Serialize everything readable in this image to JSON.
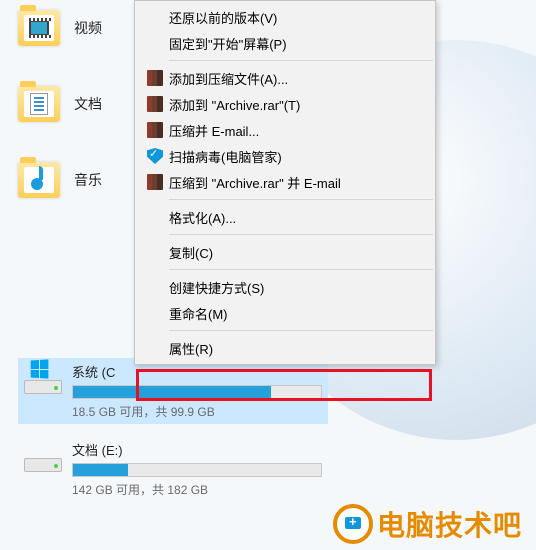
{
  "libraries": [
    {
      "id": "videos",
      "label": "视频",
      "icon": "film"
    },
    {
      "id": "documents",
      "label": "文档",
      "icon": "docicon"
    },
    {
      "id": "music",
      "label": "音乐",
      "icon": "note"
    }
  ],
  "drives": [
    {
      "id": "system",
      "title_visible": "系统 (C",
      "selected": true,
      "fill_pct": 80,
      "subtext_visible": "18.5 GB 可用，共 99.9 GB",
      "has_winlogo": true
    },
    {
      "id": "docs",
      "title": "文档 (E:)",
      "selected": false,
      "fill_pct": 22,
      "subtext": "142 GB 可用，共 182 GB",
      "has_winlogo": false
    }
  ],
  "context_menu": {
    "groups": [
      [
        {
          "id": "restore-prev",
          "label": "还原以前的版本(V)",
          "icon": null
        },
        {
          "id": "pin-start",
          "label": "固定到\"开始\"屏幕(P)",
          "icon": null
        }
      ],
      [
        {
          "id": "add-to-archive",
          "label": "添加到压缩文件(A)...",
          "icon": "books"
        },
        {
          "id": "add-to-rar",
          "label": "添加到 \"Archive.rar\"(T)",
          "icon": "books"
        },
        {
          "id": "compress-email",
          "label": "压缩并 E-mail...",
          "icon": "books"
        },
        {
          "id": "scan-virus",
          "label": "扫描病毒(电脑管家)",
          "icon": "shield"
        },
        {
          "id": "rar-and-email",
          "label": "压缩到 \"Archive.rar\" 并 E-mail",
          "icon": "books"
        }
      ],
      [
        {
          "id": "format",
          "label": "格式化(A)...",
          "icon": null
        }
      ],
      [
        {
          "id": "copy",
          "label": "复制(C)",
          "icon": null
        }
      ],
      [
        {
          "id": "create-shortcut",
          "label": "创建快捷方式(S)",
          "icon": null
        },
        {
          "id": "rename",
          "label": "重命名(M)",
          "icon": null
        }
      ],
      [
        {
          "id": "properties",
          "label": "属性(R)",
          "icon": null,
          "highlight": true
        }
      ]
    ]
  },
  "brand": {
    "text": "电脑技术吧"
  }
}
